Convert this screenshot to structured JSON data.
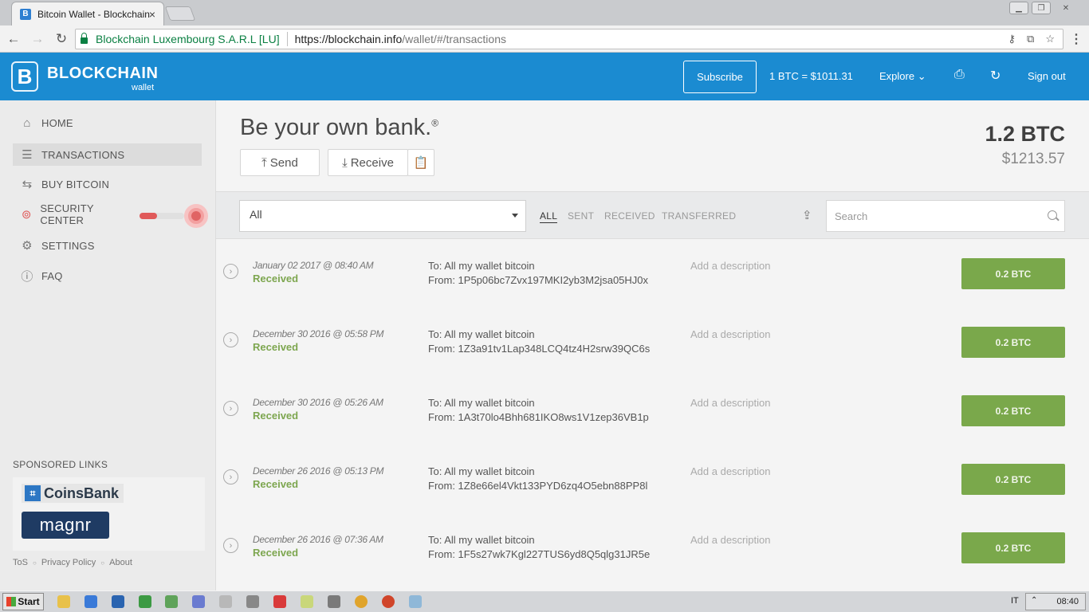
{
  "browser": {
    "tab_title": "Bitcoin Wallet - Blockchain",
    "tab_close": "×",
    "favicon_letter": "B",
    "ev_cert": "Blockchain Luxembourg S.A.R.L [LU]",
    "url_scheme_host": "https://blockchain.info",
    "url_path": "/wallet/#/transactions"
  },
  "header": {
    "logo_mark": "B",
    "logo_text": "BLOCKCHAIN",
    "logo_sub": "wallet",
    "subscribe_label": "Subscribe",
    "rate": "1 BTC =  $1011.31",
    "explore_label": "Explore",
    "signout_label": "Sign out"
  },
  "sidebar": {
    "items": [
      {
        "label": "HOME",
        "icon": "home-icon"
      },
      {
        "label": "TRANSACTIONS",
        "icon": "list-icon"
      },
      {
        "label": "BUY BITCOIN",
        "icon": "exchange-icon"
      },
      {
        "label": "SECURITY CENTER",
        "icon": "lock-icon"
      },
      {
        "label": "SETTINGS",
        "icon": "gear-icon"
      },
      {
        "label": "FAQ",
        "icon": "question-icon"
      }
    ],
    "security_level": 0.4,
    "sponsored_title": "SPONSORED LINKS",
    "ads": [
      "CoinsBank",
      "magnr"
    ],
    "footer": [
      "ToS",
      "Privacy Policy",
      "About"
    ]
  },
  "main": {
    "headline": "Be your own bank.",
    "headline_mark": "®",
    "send_label": "Send",
    "receive_label": "Receive",
    "balance_btc": "1.2 BTC",
    "balance_usd": "$1213.57"
  },
  "filters": {
    "select_value": "All",
    "tabs": [
      "ALL",
      "SENT",
      "RECEIVED",
      "TRANSFERRED"
    ],
    "active_tab": "ALL",
    "search_placeholder": "Search"
  },
  "transactions": [
    {
      "date": "January 02 2017 @ 08:40 AM",
      "status": "Received",
      "to": "To: All my wallet bitcoin",
      "from": "From: 1P5p06bc7Zvx197MKI2yb3M2jsa05HJ0x",
      "description": "Add a description",
      "amount": "0.2 BTC"
    },
    {
      "date": "December 30 2016 @ 05:58 PM",
      "status": "Received",
      "to": "To: All my wallet bitcoin",
      "from": "From: 1Z3a91tv1Lap348LCQ4tz4H2srw39QC6s",
      "description": "Add a description",
      "amount": "0.2 BTC"
    },
    {
      "date": "December 30 2016 @ 05:26 AM",
      "status": "Received",
      "to": "To: All my wallet bitcoin",
      "from": "From: 1A3t70lo4Bhh681IKO8ws1V1zep36VB1p",
      "description": "Add a description",
      "amount": "0.2 BTC"
    },
    {
      "date": "December 26 2016 @ 05:13 PM",
      "status": "Received",
      "to": "To: All my wallet bitcoin",
      "from": "From: 1Z8e66el4Vkt133PYD6zq4O5ebn88PP8l",
      "description": "Add a description",
      "amount": "0.2 BTC"
    },
    {
      "date": "December 26 2016 @ 07:36 AM",
      "status": "Received",
      "to": "To: All my wallet bitcoin",
      "from": "From: 1F5s27wk7Kgl227TUS6yd8Q5qlg31JR5e",
      "description": "Add a description",
      "amount": "0.2 BTC"
    }
  ],
  "taskbar": {
    "start_label": "Start",
    "language": "IT",
    "clock": "08:40"
  },
  "colors": {
    "brand_blue": "#1b8bd1",
    "received_green": "#7da64f",
    "amount_button": "#7aa84b",
    "security_red": "#e05a5a"
  }
}
